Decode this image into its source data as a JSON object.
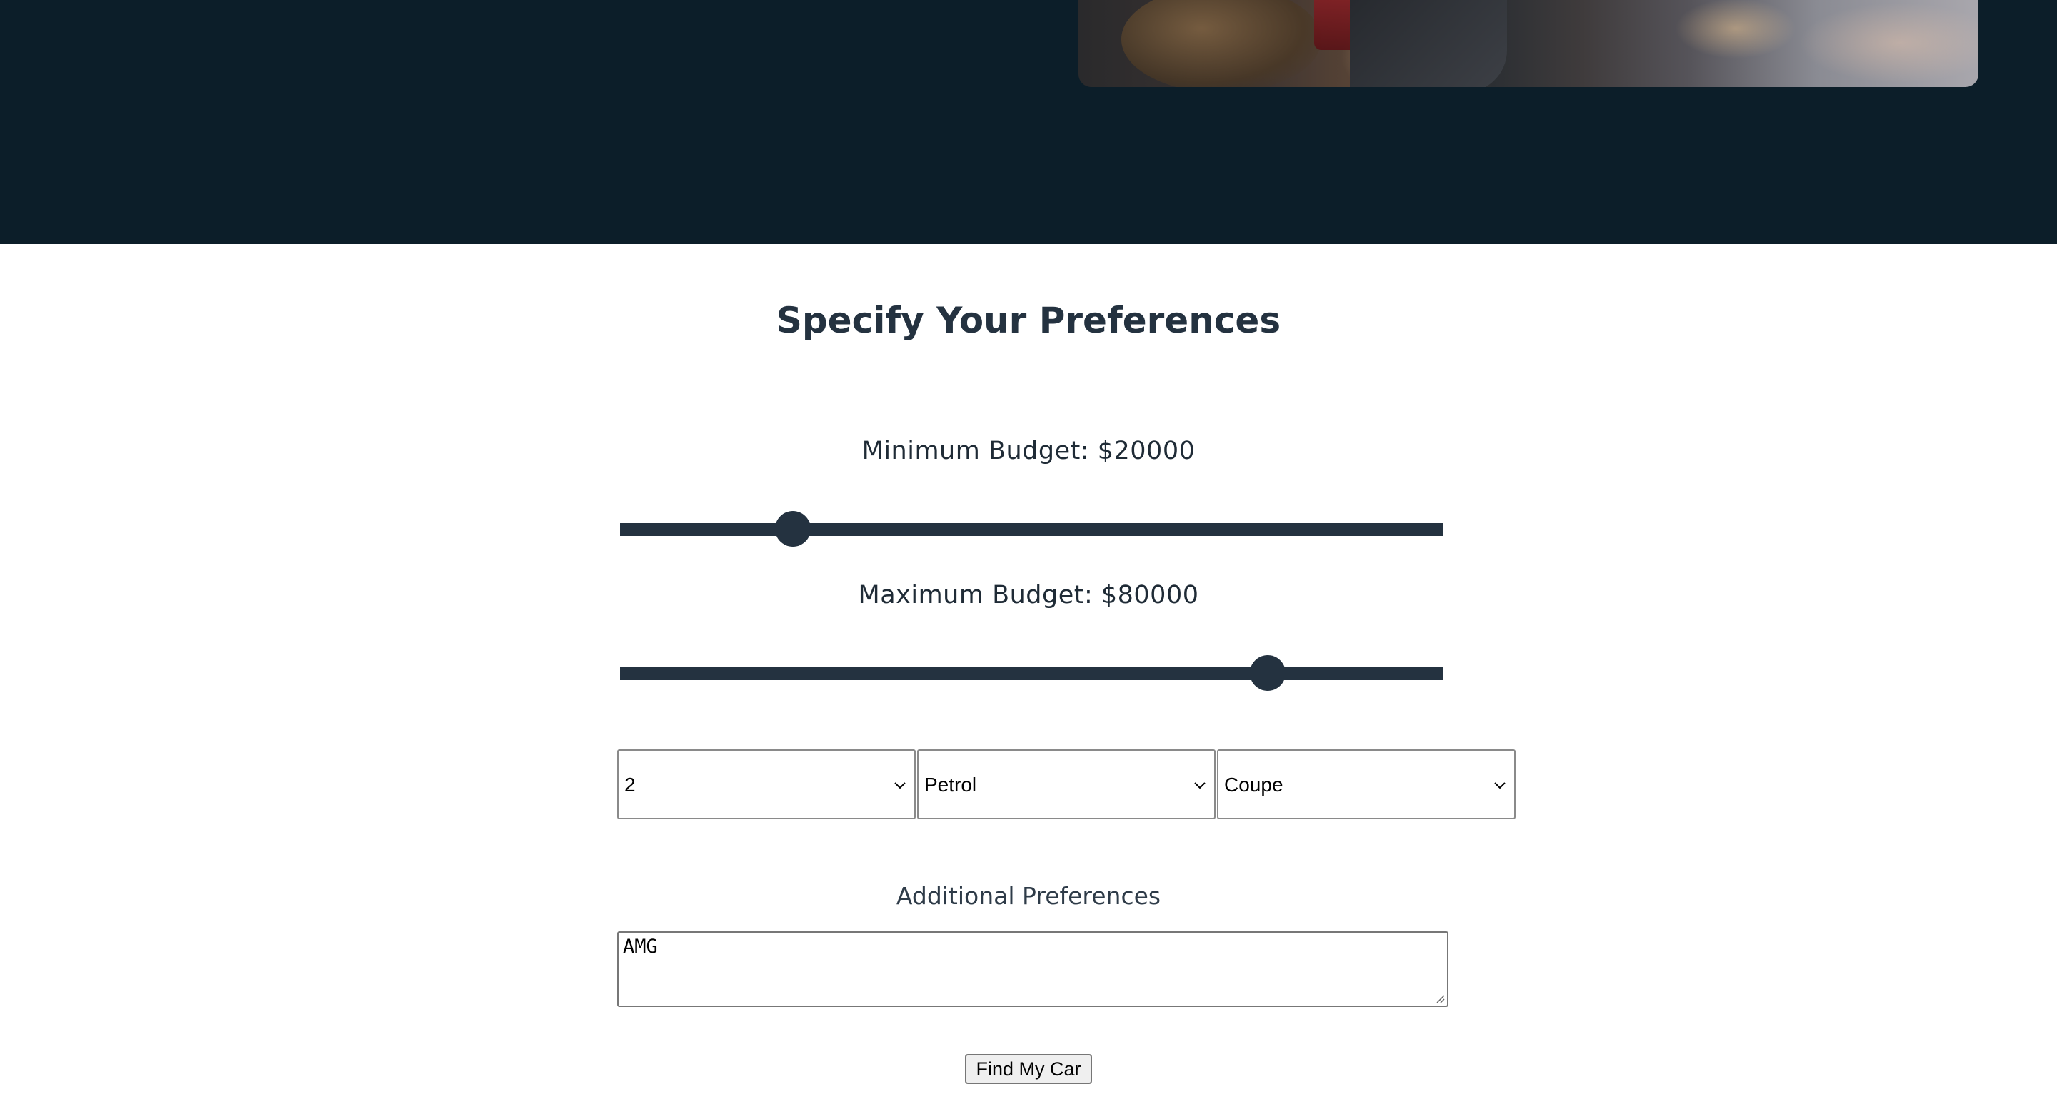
{
  "hero": {
    "background": "#0c1e29",
    "photo_alt": "woman with car"
  },
  "preferences": {
    "title": "Specify Your Preferences",
    "min_budget": {
      "label_prefix": "Minimum Budget: $",
      "value": "20000",
      "label": "Minimum Budget: $20000",
      "slider_fraction": 0.21
    },
    "max_budget": {
      "label_prefix": "Maximum Budget: $",
      "value": "80000",
      "label": "Maximum Budget: $80000",
      "slider_fraction": 0.787
    },
    "selects": [
      {
        "name": "seats-select",
        "value": "2"
      },
      {
        "name": "fuel-select",
        "value": "Petrol"
      },
      {
        "name": "body-select",
        "value": "Coupe"
      }
    ],
    "additional_label": "Additional Preferences",
    "additional_value": "AMG",
    "submit_label": "Find My Car"
  },
  "colors": {
    "accent": "#243240",
    "hero_bg": "#0c1e29"
  },
  "icons": {
    "select_chevron": "chevron-down-icon",
    "resize_handle": "resize-grip-icon"
  }
}
